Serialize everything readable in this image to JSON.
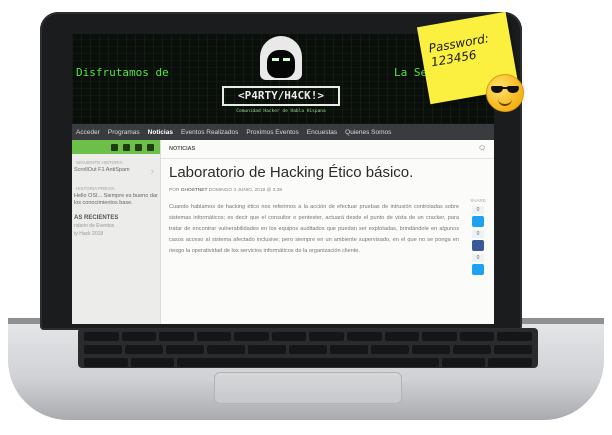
{
  "banner": {
    "left_text": "Disfrutamos de",
    "right_text": "La Segur",
    "brand": "<P4RTY/H4CK!>",
    "tagline": "Comunidad Hacker de Habla Hispana"
  },
  "nav": {
    "items": [
      "Acceder",
      "Programas",
      "Noticias",
      "Eventos Realizados",
      "Proximos Eventos",
      "Encuestas",
      "Quienes Somos"
    ],
    "active_index": 2
  },
  "sidebar": {
    "next_label": "SIGUIENTE HISTORIA",
    "next_title": "ScrollOut F1 AntiSpam",
    "prev_label": "HISTORIA PREVIA",
    "prev_title": "Hello OSI... Siempre es bueno dar los conocimientos base.",
    "recent_heading": "AS RECIENTES",
    "recent_items": [
      "ndario de Eventos",
      "ty Hack 2018"
    ]
  },
  "content": {
    "section": "NOTICIAS",
    "title": "Laboratorio de Hacking Ético básico.",
    "meta_prefix": "POR",
    "author": "GHOSTNET",
    "date": "DOMINGO 3 JUNIO, 2018 @ 3:38",
    "body": "Cuando hablamos de hacking ético nos referimos a la acción de efectuar pruebas de intrusión controladas sobre sistemas informáticos; es decir que el consultor o pentester, actuará desde el punto de vista de un cracker, para tratar de encontrar vulnerabilidades en los equipos auditados que puedan ser explotadas, brindándole en algunos casos acceso al sistema afectado inclusive; pero siempre en un ambiente supervisado, en el que no se ponga en riesgo la operatividad de los servicios informáticos de la organización cliente."
  },
  "share": {
    "label": "SHARE",
    "counts": [
      "0",
      "0",
      "0"
    ],
    "colors": {
      "twitter": "#1da1f2",
      "facebook": "#3b5998"
    }
  },
  "note": {
    "line1": "Password:",
    "line2": "123456"
  },
  "colors": {
    "accent_green": "#57e04a",
    "social_bar": "#6cc04a",
    "note": "#fbef3f"
  }
}
